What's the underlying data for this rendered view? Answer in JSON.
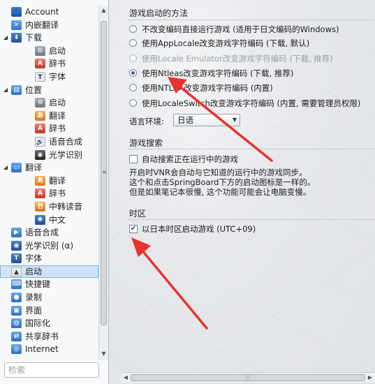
{
  "sidebar": {
    "items": [
      {
        "label": "Account",
        "level": 0,
        "icon": "user-icon",
        "color": "navy",
        "glyph": "👤"
      },
      {
        "label": "内嵌翻译",
        "level": 0,
        "icon": "translate-icon",
        "color": "blue",
        "glyph": "✕"
      },
      {
        "label": "下载",
        "level": 0,
        "icon": "download-icon",
        "color": "navy",
        "glyph": "⬇",
        "expand": "◢"
      },
      {
        "label": "启动",
        "level": 2,
        "icon": "gear-icon",
        "color": "gray",
        "glyph": "⚙"
      },
      {
        "label": "辞书",
        "level": 2,
        "icon": "dictionary-icon",
        "color": "red",
        "glyph": "A"
      },
      {
        "label": "字体",
        "level": 2,
        "icon": "font-icon",
        "color": "light",
        "glyph": "T"
      },
      {
        "label": "位置",
        "level": 0,
        "icon": "location-icon",
        "color": "blue",
        "glyph": "▤",
        "expand": "◢"
      },
      {
        "label": "启动",
        "level": 2,
        "icon": "gear-icon",
        "color": "gray",
        "glyph": "⚙"
      },
      {
        "label": "翻译",
        "level": 2,
        "icon": "translate-icon",
        "color": "orange",
        "glyph": "あ"
      },
      {
        "label": "辞书",
        "level": 2,
        "icon": "dictionary-icon",
        "color": "red",
        "glyph": "A"
      },
      {
        "label": "语音合成",
        "level": 2,
        "icon": "speaker-icon",
        "color": "light",
        "glyph": "🔊"
      },
      {
        "label": "光学识别",
        "level": 2,
        "icon": "ocr-icon",
        "color": "dark",
        "glyph": "◉"
      },
      {
        "label": "翻译",
        "level": 0,
        "icon": "translate-icon",
        "color": "blue",
        "glyph": "▭",
        "expand": "◢"
      },
      {
        "label": "翻译",
        "level": 2,
        "icon": "translate-icon",
        "color": "orange",
        "glyph": "あ"
      },
      {
        "label": "辞书",
        "level": 2,
        "icon": "dictionary-icon",
        "color": "red",
        "glyph": "A"
      },
      {
        "label": "中韩读音",
        "level": 2,
        "icon": "korean-icon",
        "color": "orange",
        "glyph": "한"
      },
      {
        "label": "中文",
        "level": 2,
        "icon": "chinese-icon",
        "color": "navy",
        "glyph": "✱"
      },
      {
        "label": "语音合成",
        "level": 0,
        "icon": "speech-icon",
        "color": "blue",
        "glyph": "▶"
      },
      {
        "label": "光学识别 (α)",
        "level": 0,
        "icon": "ocr-icon",
        "color": "navy",
        "glyph": "◉"
      },
      {
        "label": "字体",
        "level": 0,
        "icon": "font-icon",
        "color": "navy",
        "glyph": "T"
      },
      {
        "label": "启动",
        "level": 0,
        "icon": "launch-icon",
        "color": "light",
        "glyph": "▲",
        "selected": true
      },
      {
        "label": "快捷键",
        "level": 0,
        "icon": "keyboard-icon",
        "color": "blue",
        "glyph": "⌨"
      },
      {
        "label": "录制",
        "level": 0,
        "icon": "record-icon",
        "color": "blue",
        "glyph": "●"
      },
      {
        "label": "界面",
        "level": 0,
        "icon": "window-icon",
        "color": "blue",
        "glyph": "▣"
      },
      {
        "label": "国际化",
        "level": 0,
        "icon": "globe-icon",
        "color": "blue",
        "glyph": "◍"
      },
      {
        "label": "共享辞书",
        "level": 0,
        "icon": "share-icon",
        "color": "blue",
        "glyph": "⇄"
      },
      {
        "label": "Internet",
        "level": 0,
        "icon": "internet-icon",
        "color": "blue",
        "glyph": "◎"
      }
    ],
    "search_placeholder": "检索"
  },
  "main": {
    "launch_section": {
      "title": "游戏启动的方法",
      "options": [
        {
          "label": "不改变编码直接运行游戏 (适用于日文编码的Windows)",
          "checked": false,
          "disabled": false
        },
        {
          "label": "使用AppLocale改变游戏字符编码 (下载, 默认)",
          "checked": false,
          "disabled": false
        },
        {
          "label": "使用Locale Emulator改变游戏字符编码 (下载, 推荐)",
          "checked": false,
          "disabled": true
        },
        {
          "label": "使用Ntleas改变游戏字符编码 (下载, 推荐)",
          "checked": true,
          "disabled": false
        },
        {
          "label": "使用NTLEA改变游戏字符编码 (内置)",
          "checked": false,
          "disabled": false
        },
        {
          "label": "使用LocaleSwitch改变游戏字符编码 (内置, 需要管理员权限)",
          "checked": false,
          "disabled": false
        }
      ],
      "language_label": "语言环境:",
      "language_value": "日语"
    },
    "search_section": {
      "title": "游戏搜索",
      "checkbox_label": "自动搜索正在运行中的游戏",
      "checkbox_checked": false,
      "lines": [
        "开启时VNR会自动与它知道的运行中的游戏同步。",
        "这个和点击SpringBoard下方的启动图标是一样的。",
        "但是如果笔记本很慢, 这个功能可能会让电脑变慢。"
      ]
    },
    "timezone_section": {
      "title": "时区",
      "checkbox_label": "以日本时区启动游戏 (UTC+09)",
      "checkbox_checked": true
    }
  },
  "colors": {
    "annotation_arrow": "#e8322b",
    "selection": "#cfe4f8",
    "radio_dot": "#2a62b6"
  }
}
